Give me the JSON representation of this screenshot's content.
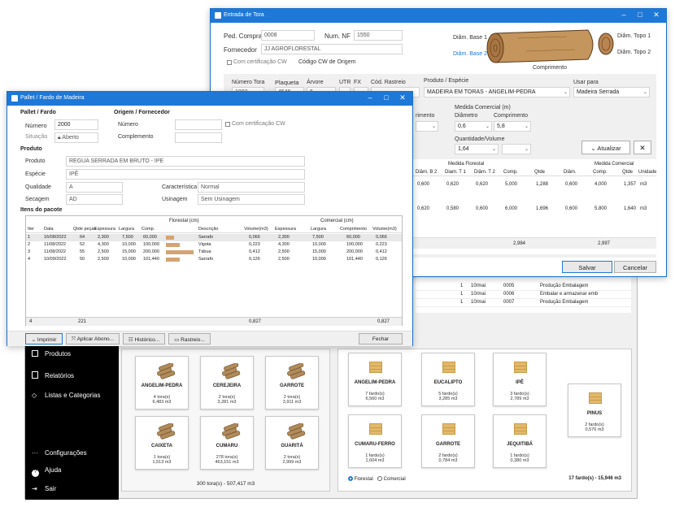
{
  "main": {
    "sidebar": {
      "items": [
        {
          "label": "Produtos",
          "icon": "box-icon"
        },
        {
          "label": "Relatórios",
          "icon": "report-icon"
        },
        {
          "label": "Listas e Categorias",
          "icon": "tag-icon"
        }
      ],
      "bottom": [
        {
          "label": "Configurações",
          "icon": "more-icon"
        },
        {
          "label": "Ajuda",
          "icon": "help-icon"
        },
        {
          "label": "Sair",
          "icon": "exit-icon"
        }
      ]
    },
    "log_rows": [
      {
        "qty": "1",
        "date": "10/mai",
        "code": "0005",
        "desc": "Produção Embalagem"
      },
      {
        "qty": "1",
        "date": "10/mai",
        "code": "0006",
        "desc": "Embalar e armazenar emb"
      },
      {
        "qty": "1",
        "date": "10/mai",
        "code": "0007",
        "desc": "Produção Embalagem"
      }
    ],
    "florestal_cards": [
      {
        "name": "ANGELIM-PEDRA",
        "line1": "4 tora(s)",
        "line2": "6,483 m3"
      },
      {
        "name": "CEREJEIRA",
        "line1": "2 tora(s)",
        "line2": "3,281 m3"
      },
      {
        "name": "GARROTE",
        "line1": "2 tora(s)",
        "line2": "3,911 m3"
      },
      {
        "name": "CAIXETA",
        "line1": "1 tora(s)",
        "line2": "1,513 m3"
      },
      {
        "name": "CUMARU",
        "line1": "278 tora(s)",
        "line2": "463,151 m3"
      },
      {
        "name": "GUARITÁ",
        "line1": "2 tora(s)",
        "line2": "2,999 m3"
      }
    ],
    "florestal_total": "300 tora(s) - 507,417 m3",
    "pallet_cards": [
      {
        "name": "ANGELIM-PEDRA",
        "line1": "7 fardo(s)",
        "line2": "6,560 m3"
      },
      {
        "name": "EUCALIPTO",
        "line1": "5 fardo(s)",
        "line2": "3,285 m3"
      },
      {
        "name": "IPÊ",
        "line1": "3 fardo(s)",
        "line2": "2,789 m3"
      },
      {
        "name": "PINUS",
        "line1": "2 fardo(s)",
        "line2": "0,576 m3"
      },
      {
        "name": "CUMARU-FERRO",
        "line1": "1 fardo(s)",
        "line2": "1,604 m3"
      },
      {
        "name": "GARROTE",
        "line1": "2 fardo(s)",
        "line2": "0,784 m3"
      },
      {
        "name": "JEQUITIBÁ",
        "line1": "1 fardo(s)",
        "line2": "0,380 m3"
      }
    ],
    "radio_florestal": "Florestal",
    "radio_comercial": "Comercial",
    "pallet_total": "17 fardo(s) - 15,946 m3"
  },
  "tora": {
    "title": "Entrada de Tora",
    "ped_compra_label": "Ped. Compra",
    "ped_compra": "0008",
    "num_nf_label": "Num. NF",
    "num_nf": "1550",
    "fornecedor_label": "Fornecedor",
    "fornecedor": "JJ AGROFLORESTAL",
    "cert_label": "Com certificação CW",
    "cw_origem_label": "Código CW de Origem",
    "diag": {
      "base1": "Diâm. Base 1",
      "base2": "Diâm. Base 2",
      "topo1": "Diâm. Topo 1",
      "topo2": "Diâm. Topo 2",
      "comprimento": "Comprimento"
    },
    "row_labels": {
      "numero_tora": "Número Tora",
      "plaqueta": "Plaqueta",
      "arvore": "Árvore",
      "utr": "UTR",
      "fx": "FX",
      "cod_rastreio": "Cód. Rastreio",
      "produto": "Produto / Espécie",
      "usar_para": "Usar para"
    },
    "row_values": {
      "numero_tora": "1002",
      "plaqueta": "4546",
      "arvore": "6",
      "produto": "MADEIRA EM TORAS - ANGELIM-PEDRA",
      "usar_para": "Madeira Serrada"
    },
    "florestal_tail": "rimento",
    "medida_comercial": {
      "title": "Medida Comercial (m)",
      "diametro_label": "Diâmetro",
      "comprimento_label": "Comprimento",
      "diametro": "0,6",
      "comprimento": "5,8",
      "qtd_label": "Quantidade/Volume",
      "qtd": "1,64"
    },
    "atualizar": "Atualizar",
    "table": {
      "group_florestal": "Medida Florestal",
      "group_comercial": "Medida Comercial",
      "headers": [
        "Diâm. B 2",
        "Diam. T 1",
        "Diâm. T 2",
        "Comp.",
        "Qtde",
        "Diâm.",
        "Comp.",
        "Qtde",
        "Unidade"
      ],
      "rows": [
        [
          "0,600",
          "0,620",
          "0,620",
          "5,000",
          "1,288",
          "0,600",
          "4,000",
          "1,357",
          "m3"
        ],
        [
          "0,620",
          "0,580",
          "0,600",
          "6,000",
          "1,696",
          "0,600",
          "5,800",
          "1,640",
          "m3"
        ]
      ],
      "total_florestal": "2,984",
      "total_comercial": "2,997"
    },
    "salvar": "Salvar",
    "cancelar": "Cancelar"
  },
  "pallet": {
    "title": "Pallet / Fardo de Madeira",
    "section_pallet": "Pallet / Fardo",
    "section_origem": "Origem / Fornecedor",
    "numero_label": "Número",
    "numero": "2000",
    "situacao_label": "Situação",
    "situacao": "Aberto",
    "origem_numero_label": "Número",
    "complemento_label": "Complemento",
    "cert_label": "Com certificação CW",
    "section_produto": "Produto",
    "produto_label": "Produto",
    "produto": "REGUA SERRADA EM BRUTO - IPE",
    "especie_label": "Espécie",
    "especie": "IPÊ",
    "qualidade_label": "Qualidade",
    "qualidade": "A",
    "caracteristica_label": "Característica",
    "caracteristica": "Normal",
    "secagem_label": "Secagem",
    "secagem": "AD",
    "usinagem_label": "Usinagem",
    "usinagem": "Sem Usinagem",
    "section_itens": "Itens do pacote",
    "table": {
      "group_florestal": "Florestal (cm)",
      "group_comercial": "Comercial (cm)",
      "headers": [
        "Iter",
        "Data",
        "Qtde peças",
        "Espessura",
        "Largura",
        "Comp.",
        "Descrição",
        "Volume(m3)",
        "Espessura",
        "Largura",
        "Comprimento",
        "Volume(m3)"
      ],
      "rows": [
        {
          "iter": "1",
          "data": "16/08/2022",
          "qtde": "64",
          "esp": "2,300",
          "larg": "7,500",
          "comp": "60,000",
          "bar": 0.3,
          "desc": "Sarrafo",
          "vol": "0,066",
          "c_esp": "2,300",
          "c_larg": "7,500",
          "c_comp": "60,000",
          "c_vol": "0,066"
        },
        {
          "iter": "2",
          "data": "11/08/2022",
          "qtde": "52",
          "esp": "4,300",
          "larg": "10,000",
          "comp": "100,000",
          "bar": 0.5,
          "desc": "Vigota",
          "vol": "0,223",
          "c_esp": "4,300",
          "c_larg": "10,000",
          "c_comp": "100,000",
          "c_vol": "0,223"
        },
        {
          "iter": "3",
          "data": "11/08/2022",
          "qtde": "55",
          "esp": "2,500",
          "larg": "15,000",
          "comp": "200,000",
          "bar": 1.0,
          "desc": "Tábua",
          "vol": "0,412",
          "c_esp": "2,500",
          "c_larg": "15,000",
          "c_comp": "200,000",
          "c_vol": "0,412"
        },
        {
          "iter": "4",
          "data": "10/09/2022",
          "qtde": "50",
          "esp": "2,500",
          "larg": "10,000",
          "comp": "101,440",
          "bar": 0.5,
          "desc": "Sarrafo",
          "vol": "0,126",
          "c_esp": "2,500",
          "c_larg": "10,000",
          "c_comp": "101,440",
          "c_vol": "0,126"
        }
      ],
      "footer_count": "4",
      "footer_qtde": "221",
      "footer_vol": "0,827",
      "footer_c_vol": "0,827"
    },
    "imprimir": "Imprimir",
    "aplicar_abono": "Aplicar Abono...",
    "historico": "Histórico...",
    "rastreio": "Rastreio...",
    "fechar": "Fechar"
  }
}
